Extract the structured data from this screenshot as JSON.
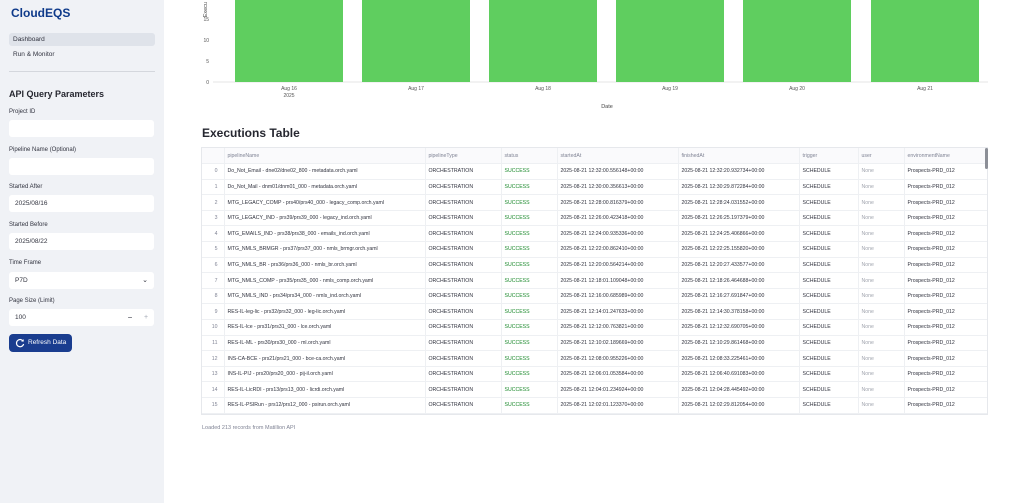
{
  "app": {
    "brand": "CloudEQS"
  },
  "sidebar": {
    "nav": [
      {
        "label": "Dashboard"
      },
      {
        "label": "Run & Monitor"
      }
    ],
    "heading": "API Query Parameters",
    "project_id": {
      "label": "Project ID",
      "value": ""
    },
    "pipeline_name": {
      "label": "Pipeline Name (Optional)",
      "value": ""
    },
    "started_after": {
      "label": "Started After",
      "value": "2025/08/16"
    },
    "started_before": {
      "label": "Started Before",
      "value": "2025/08/22"
    },
    "time_frame": {
      "label": "Time Frame",
      "value": "P7D"
    },
    "page_size": {
      "label": "Page Size (Limit)",
      "value": "100",
      "minus": "−",
      "plus": "+"
    },
    "refresh_label": "Refresh Data",
    "icons": {
      "refresh": "refresh-icon",
      "chevron": "chevron-down-icon"
    }
  },
  "chart_data": {
    "type": "bar",
    "ylabel": "Execu",
    "y_ticks": [
      "15",
      "10",
      "5",
      "0"
    ],
    "x_ticks": [
      "Aug 16",
      "Aug 17",
      "Aug 18",
      "Aug 19",
      "Aug 20",
      "Aug 21"
    ],
    "x_sublabel": "2025",
    "xlabel": "Date",
    "bar_color": "#5fce5f"
  },
  "table": {
    "title": "Executions Table",
    "columns": [
      "",
      "pipelineName",
      "pipelineType",
      "status",
      "startedAt",
      "finishedAt",
      "trigger",
      "user",
      "environmentName"
    ],
    "rows": [
      [
        "0",
        "Do_Not_Email - dne02/dne02_800 - metadata.orch.yaml",
        "ORCHESTRATION",
        "SUCCESS",
        "2025-08-21 12:32:00.556148+00:00",
        "2025-08-21 12:32:20.932734+00:00",
        "SCHEDULE",
        "None",
        "Prospects-PRD_012"
      ],
      [
        "1",
        "Do_Not_Mail - dnm01/dnm01_000 - metadata.orch.yaml",
        "ORCHESTRATION",
        "SUCCESS",
        "2025-08-21 12:30:00.356613+00:00",
        "2025-08-21 12:30:29.872284+00:00",
        "SCHEDULE",
        "None",
        "Prospects-PRD_012"
      ],
      [
        "2",
        "MTG_LEGACY_COMP - prs40/prs40_000 - legacy_comp.orch.yaml",
        "ORCHESTRATION",
        "SUCCESS",
        "2025-08-21 12:28:00.816379+00:00",
        "2025-08-21 12:28:24.031552+00:00",
        "SCHEDULE",
        "None",
        "Prospects-PRD_012"
      ],
      [
        "3",
        "MTG_LEGACY_IND - prs39/prs39_000 - legacy_ind.orch.yaml",
        "ORCHESTRATION",
        "SUCCESS",
        "2025-08-21 12:26:00.423418+00:00",
        "2025-08-21 12:26:25.197379+00:00",
        "SCHEDULE",
        "None",
        "Prospects-PRD_012"
      ],
      [
        "4",
        "MTG_EMAILS_IND - prs38/prs38_000 - emails_ind.orch.yaml",
        "ORCHESTRATION",
        "SUCCESS",
        "2025-08-21 12:24:00.935336+00:00",
        "2025-08-21 12:24:25.406866+00:00",
        "SCHEDULE",
        "None",
        "Prospects-PRD_012"
      ],
      [
        "5",
        "MTG_NMLS_BRMGR - prs37/prs37_000 - nmls_brmgr.orch.yaml",
        "ORCHESTRATION",
        "SUCCESS",
        "2025-08-21 12:22:00.862410+00:00",
        "2025-08-21 12:22:25.155820+00:00",
        "SCHEDULE",
        "None",
        "Prospects-PRD_012"
      ],
      [
        "6",
        "MTG_NMLS_BR - prs36/prs36_000 - nmls_br.orch.yaml",
        "ORCHESTRATION",
        "SUCCESS",
        "2025-08-21 12:20:00.564214+00:00",
        "2025-08-21 12:20:27.433577+00:00",
        "SCHEDULE",
        "None",
        "Prospects-PRD_012"
      ],
      [
        "7",
        "MTG_NMLS_COMP - prs35/prs35_000 - nmls_comp.orch.yaml",
        "ORCHESTRATION",
        "SUCCESS",
        "2025-08-21 12:18:01.109048+00:00",
        "2025-08-21 12:18:26.464688+00:00",
        "SCHEDULE",
        "None",
        "Prospects-PRD_012"
      ],
      [
        "8",
        "MTG_NMLS_IND - prs34/prs34_000 - nmls_ind.orch.yaml",
        "ORCHESTRATION",
        "SUCCESS",
        "2025-08-21 12:16:00.685989+00:00",
        "2025-08-21 12:16:27.691847+00:00",
        "SCHEDULE",
        "None",
        "Prospects-PRD_012"
      ],
      [
        "9",
        "RES-IL-leg-lic - prs32/prs32_000 - leg-lic.orch.yaml",
        "ORCHESTRATION",
        "SUCCESS",
        "2025-08-21 12:14:01.247633+00:00",
        "2025-08-21 12:14:30.378158+00:00",
        "SCHEDULE",
        "None",
        "Prospects-PRD_012"
      ],
      [
        "10",
        "RES-IL-lce - prs31/prs31_000 - lce.orch.yaml",
        "ORCHESTRATION",
        "SUCCESS",
        "2025-08-21 12:12:00.763821+00:00",
        "2025-08-21 12:12:32.690705+00:00",
        "SCHEDULE",
        "None",
        "Prospects-PRD_012"
      ],
      [
        "11",
        "RES-IL-ML - prs30/prs30_000 - ml.orch.yaml",
        "ORCHESTRATION",
        "SUCCESS",
        "2025-08-21 12:10:02.189669+00:00",
        "2025-08-21 12:10:29.861468+00:00",
        "SCHEDULE",
        "None",
        "Prospects-PRD_012"
      ],
      [
        "12",
        "INS-CA-BCE - prs21/prs21_000 - bce-ca.orch.yaml",
        "ORCHESTRATION",
        "SUCCESS",
        "2025-08-21 12:08:00.955226+00:00",
        "2025-08-21 12:08:33.225461+00:00",
        "SCHEDULE",
        "None",
        "Prospects-PRD_012"
      ],
      [
        "13",
        "INS-IL-PIJ - prs20/prs20_000 - pij-il.orch.yaml",
        "ORCHESTRATION",
        "SUCCESS",
        "2025-08-21 12:06:01.053584+00:00",
        "2025-08-21 12:06:40.691083+00:00",
        "SCHEDULE",
        "None",
        "Prospects-PRD_012"
      ],
      [
        "14",
        "RES-IL-LicRDI - prs13/prs13_000 - licrdi.orch.yaml",
        "ORCHESTRATION",
        "SUCCESS",
        "2025-08-21 12:04:01.234924+00:00",
        "2025-08-21 12:04:28.445492+00:00",
        "SCHEDULE",
        "None",
        "Prospects-PRD_012"
      ],
      [
        "15",
        "RES-IL-PSIRun - prs12/prs12_000 - psirun.orch.yaml",
        "ORCHESTRATION",
        "SUCCESS",
        "2025-08-21 12:02:01.123370+00:00",
        "2025-08-21 12:02:29.812054+00:00",
        "SCHEDULE",
        "None",
        "Prospects-PRD_012"
      ]
    ],
    "footer": "Loaded 213 records from Matillion API"
  },
  "colors": {
    "accent": "#1a3d8f",
    "success": "#1e8b2f",
    "bar": "#5fce5f"
  }
}
